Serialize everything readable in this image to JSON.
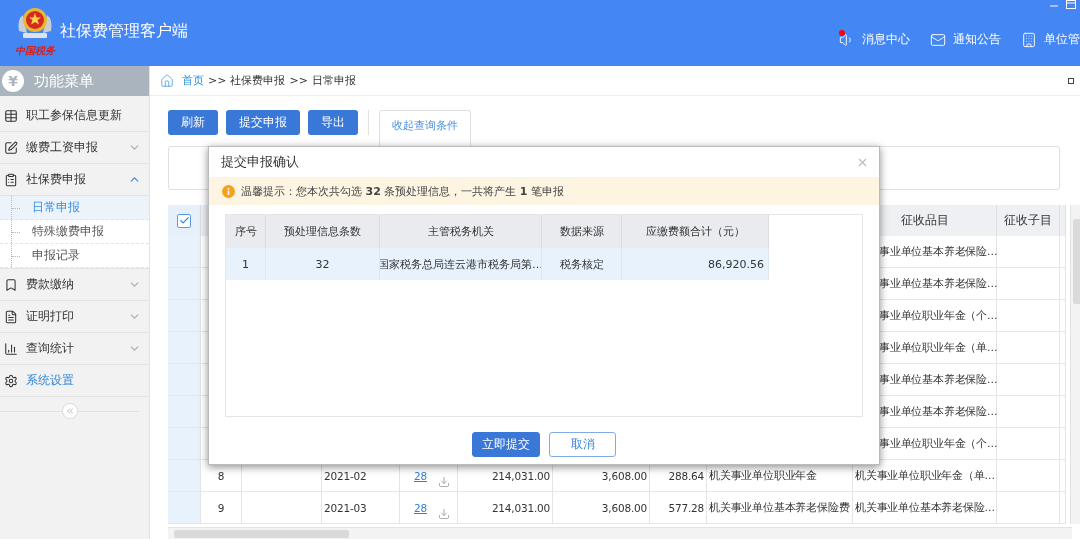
{
  "header": {
    "logo_text": "中国税务",
    "title": "社保费管理客户端",
    "nav": [
      {
        "label": "消息中心",
        "has_dot": true
      },
      {
        "label": "通知公告",
        "has_dot": false
      },
      {
        "label": "单位管",
        "has_dot": false
      }
    ]
  },
  "sidebar": {
    "icon_char": "¥",
    "title": "功能菜单",
    "items": [
      {
        "label": "职工参保信息更新",
        "hovered": false
      },
      {
        "label": "缴费工资申报",
        "expanded": false,
        "hovered": false
      },
      {
        "label": "社保费申报",
        "expanded": true,
        "hovered": false,
        "children": [
          {
            "label": "日常申报",
            "selected": true
          },
          {
            "label": "特殊缴费申报",
            "selected": false
          },
          {
            "label": "申报记录",
            "selected": false
          }
        ]
      },
      {
        "label": "费款缴纳",
        "expanded": false,
        "hovered": false
      },
      {
        "label": "证明打印",
        "expanded": false,
        "hovered": false
      },
      {
        "label": "查询统计",
        "expanded": false,
        "hovered": false
      },
      {
        "label": "系统设置",
        "hovered": true
      }
    ]
  },
  "breadcrumb": [
    {
      "kind": "link",
      "label": "首页"
    },
    {
      "kind": "sep",
      "label": ">>"
    },
    {
      "kind": "text",
      "label": "社保费申报"
    },
    {
      "kind": "sep",
      "label": ">>"
    },
    {
      "kind": "text",
      "label": "日常申报"
    }
  ],
  "toolbar": {
    "buttons": [
      "刷新",
      "提交申报",
      "导出"
    ],
    "toggle": "收起查询条件"
  },
  "table": {
    "header_checked": true,
    "columns": [
      "征收品目",
      "征收子目"
    ],
    "rows": [
      {
        "item": "事业单位基本养老保险…"
      },
      {
        "item": "事业单位基本养老保险…"
      },
      {
        "item": "事业单位职业年金（个…"
      },
      {
        "item": "事业单位职业年金（单…"
      },
      {
        "item": "事业单位基本养老保险…"
      },
      {
        "item": "事业单位基本养老保险…"
      },
      {
        "item": "事业单位职业年金（个…"
      },
      {
        "no": "8",
        "period": "2021-02",
        "count": "28",
        "base": "214,031.00",
        "amount": "3,608.00",
        "fee": "288.64",
        "name": "机关事业单位职业年金",
        "item": "机关事业单位职业年金（单…"
      },
      {
        "no": "9",
        "period": "2021-03",
        "count": "28",
        "base": "214,031.00",
        "amount": "3,608.00",
        "fee": "577.28",
        "name": "机关事业单位基本养老保险费",
        "item": "机关事业单位基本养老保险…"
      }
    ]
  },
  "dialog": {
    "title": "提交申报确认",
    "notice": "温馨提示：您本次共勾选 **32** 条预处理信息，一共将产生 **1** 笔申报",
    "columns": [
      "序号",
      "预处理信息条数",
      "主管税务机关",
      "数据来源",
      "应缴费额合计（元）"
    ],
    "rows": [
      {
        "selected": true,
        "cells": [
          "1",
          "32",
          "国家税务总局连云港市税务局第…",
          "税务核定",
          "86,920.56"
        ]
      }
    ],
    "buttons": [
      {
        "label": "立即提交",
        "primary": true
      },
      {
        "label": "取消",
        "primary": false
      }
    ]
  }
}
